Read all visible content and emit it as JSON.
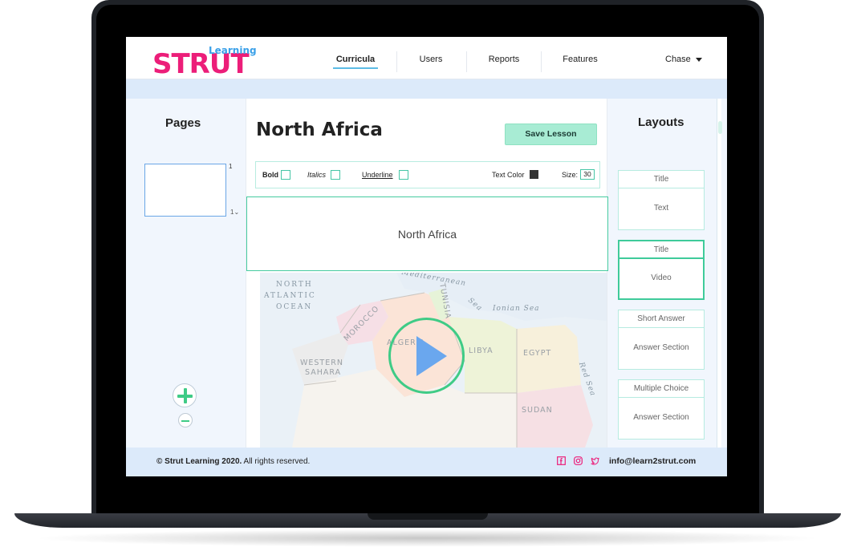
{
  "brand": {
    "logo_main": "STRUT",
    "logo_sub": "Learning",
    "pink": "#ec1e79",
    "blue": "#3aa0e8",
    "accent_green": "#3fcb86"
  },
  "nav": {
    "items": [
      {
        "label": "Curricula",
        "active": true
      },
      {
        "label": "Users"
      },
      {
        "label": "Reports"
      },
      {
        "label": "Features"
      }
    ],
    "user_label": "Chase"
  },
  "pages": {
    "title": "Pages",
    "thumb_number": "1",
    "select_value": "1"
  },
  "lesson": {
    "title": "North Africa",
    "save_label": "Save Lesson"
  },
  "toolbar": {
    "bold_label": "Bold",
    "italics_label": "Italics",
    "underline_label": "Underline",
    "color_label": "Text Color",
    "size_label": "Size:",
    "size_value": "30"
  },
  "content": {
    "title_text": "North Africa"
  },
  "map": {
    "ocean_1": "NORTH",
    "ocean_2": "ATLANTIC",
    "ocean_3": "OCEAN",
    "sea_1": "Mediterranean",
    "sea_2": "Sea",
    "sea_3": "Ionian Sea",
    "sea_4": "Red Sea",
    "morocco": "MOROCCO",
    "algeria": "ALGERIA",
    "tunisia": "TUNISIA",
    "libya": "LIBYA",
    "egypt": "EGYPT",
    "western_sahara_1": "WESTERN",
    "western_sahara_2": "SAHARA",
    "sudan": "SUDAN"
  },
  "layouts": {
    "title": "Layouts",
    "cards": [
      {
        "head": "Title",
        "body": "Text"
      },
      {
        "head": "Title",
        "body": "Video",
        "selected": true
      },
      {
        "head": "Short Answer",
        "body": "Answer Section"
      },
      {
        "head": "Multiple Choice",
        "body": "Answer Section"
      }
    ]
  },
  "footer": {
    "copyright_bold": "© Strut Learning 2020.",
    "copyright_rest": " All rights reserved.",
    "email": "info@learn2strut.com",
    "social_icons": [
      "facebook-icon",
      "instagram-icon",
      "twitter-icon"
    ]
  }
}
